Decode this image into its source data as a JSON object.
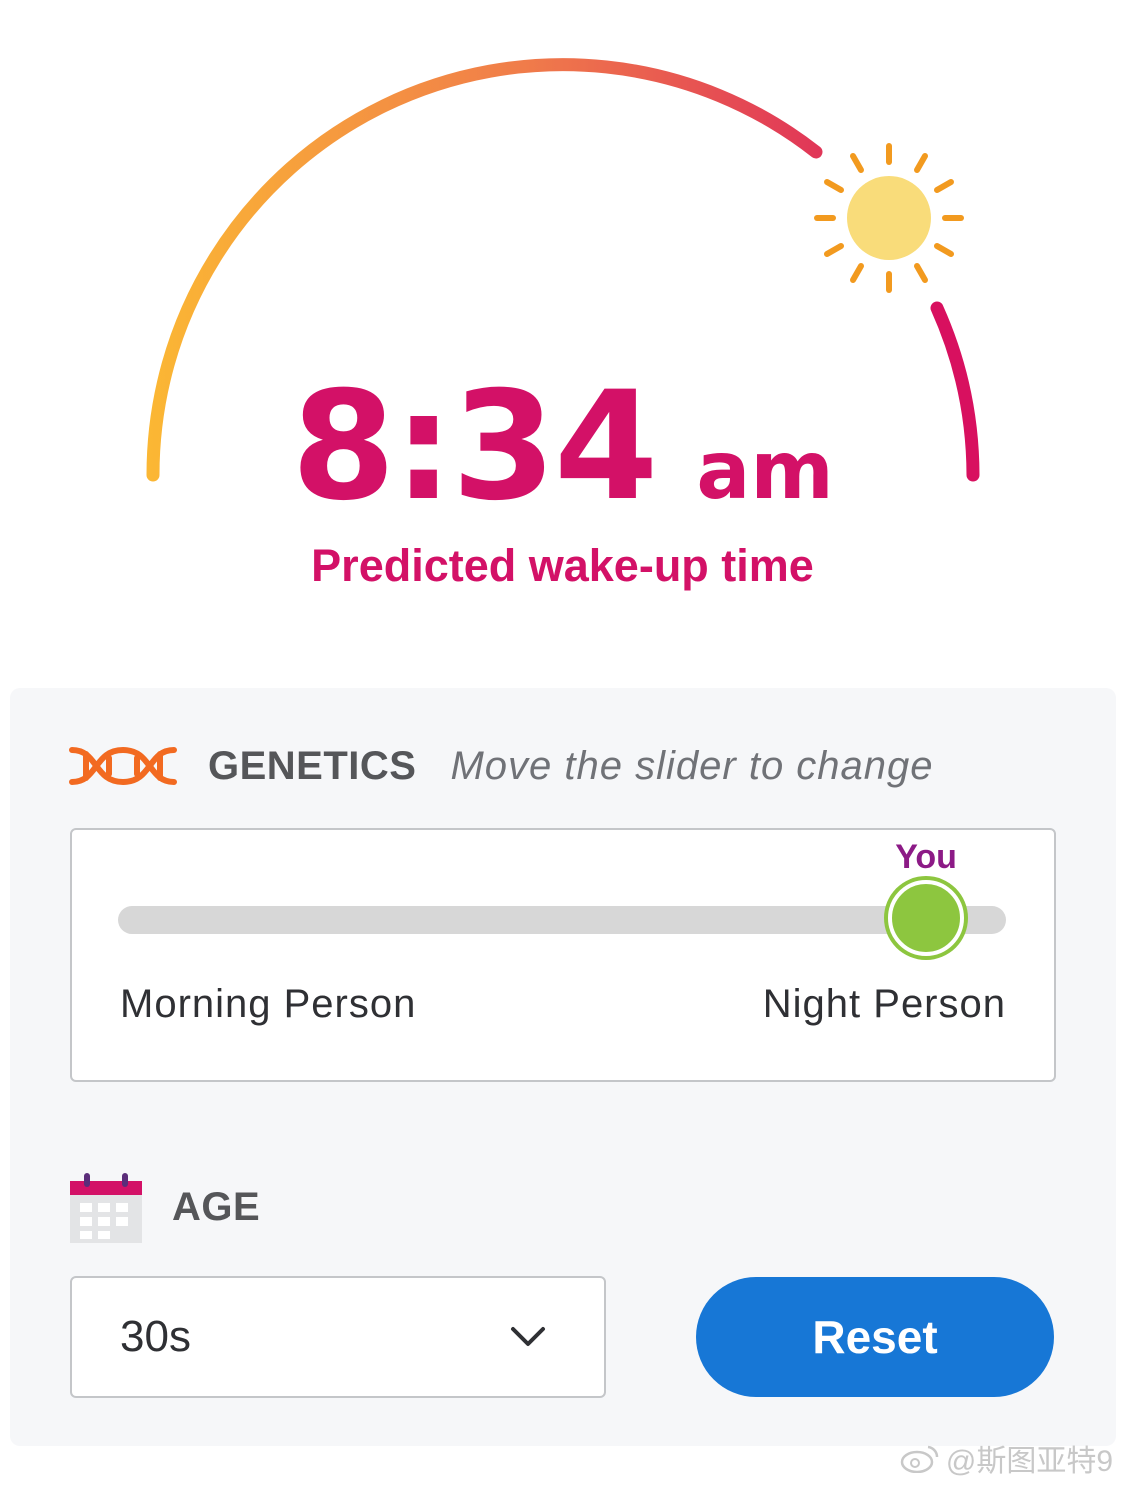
{
  "colors": {
    "accent": "#d31167",
    "arc_start": "#fbb734",
    "arc_end": "#d8105f",
    "sun_rays": "#f29a1f",
    "sun_core": "#f9dc7a",
    "slider_thumb": "#8dc63f",
    "you_label": "#8c1a86",
    "reset_button": "#1777d6",
    "dna_icon": "#f26a21"
  },
  "prediction": {
    "time": "8:34",
    "ampm": "am",
    "label": "Predicted wake-up time"
  },
  "genetics": {
    "icon": "dna-icon",
    "title": "GENETICS",
    "hint": "Move the slider to change",
    "slider": {
      "marker_label": "You",
      "left_label": "Morning Person",
      "right_label": "Night Person",
      "value_fraction": 0.91
    }
  },
  "age": {
    "icon": "calendar-icon",
    "title": "AGE",
    "select_value": "30s"
  },
  "actions": {
    "reset_label": "Reset"
  },
  "watermark": {
    "text": "@斯图亚特9"
  }
}
